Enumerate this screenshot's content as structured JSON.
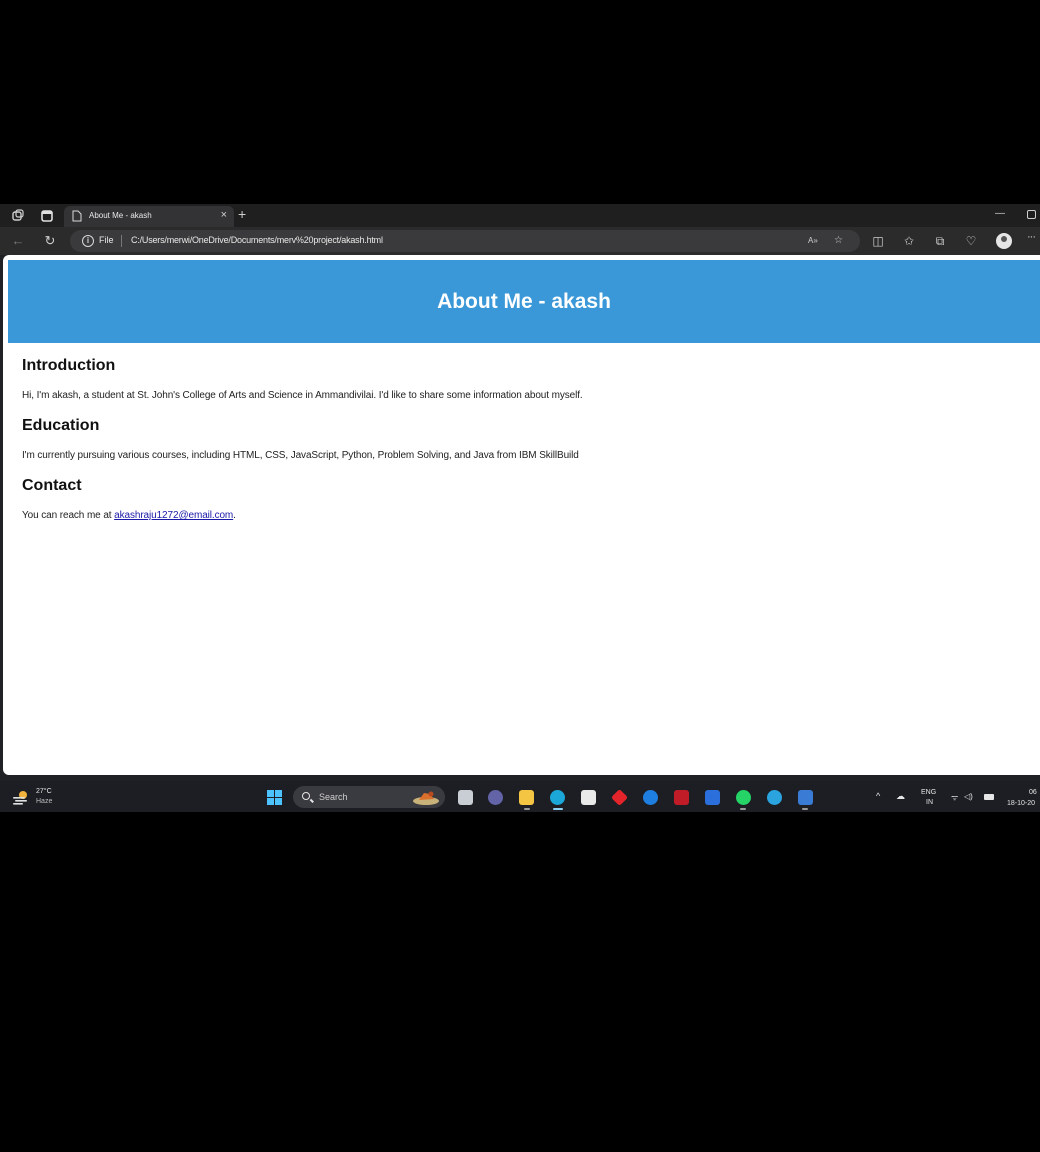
{
  "browser": {
    "tab_title": "About Me - akash",
    "tab_close": "×",
    "new_tab": "+",
    "window_minimize": "—",
    "address": {
      "scheme_label": "File",
      "url": "C:/Users/merwi/OneDrive/Documents/merv%20project/akash.html"
    },
    "more_menu": "···"
  },
  "page": {
    "header_title": "About Me - akash",
    "sections": [
      {
        "title": "Introduction",
        "text": "Hi, I'm akash, a student at St. John's College of Arts and Science in Ammandivilai. I'd like to share some information about myself."
      },
      {
        "title": "Education",
        "text": "I'm currently pursuing various courses, including HTML, CSS, JavaScript, Python, Problem Solving, and Java from IBM SkillBuild"
      },
      {
        "title": "Contact",
        "text_before": "You can reach me at ",
        "email": "akashraju1272@email.com",
        "text_after": "."
      }
    ]
  },
  "taskbar": {
    "weather_temp": "27°C",
    "weather_desc": "Haze",
    "search_placeholder": "Search",
    "tray_lang_top": "ENG",
    "tray_lang_bottom": "IN",
    "clock_time": "06",
    "clock_date": "18-10-20"
  },
  "colors": {
    "header_blue": "#3a98d8",
    "link": "#1a1aa8",
    "taskbar": "#1c1e23"
  }
}
